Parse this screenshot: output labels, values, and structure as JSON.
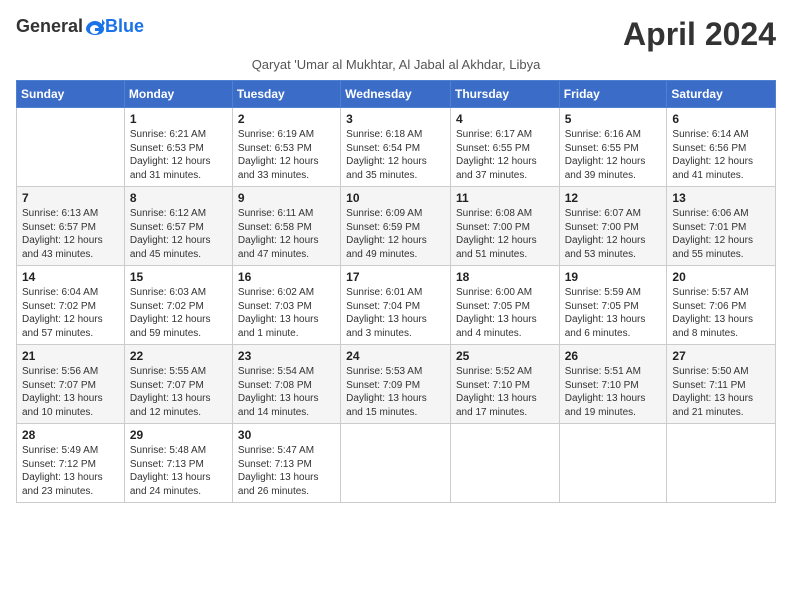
{
  "header": {
    "logo_general": "General",
    "logo_blue": "Blue",
    "month_title": "April 2024",
    "subtitle": "Qaryat 'Umar al Mukhtar, Al Jabal al Akhdar, Libya"
  },
  "columns": [
    "Sunday",
    "Monday",
    "Tuesday",
    "Wednesday",
    "Thursday",
    "Friday",
    "Saturday"
  ],
  "weeks": [
    [
      {
        "day": "",
        "info": ""
      },
      {
        "day": "1",
        "info": "Sunrise: 6:21 AM\nSunset: 6:53 PM\nDaylight: 12 hours\nand 31 minutes."
      },
      {
        "day": "2",
        "info": "Sunrise: 6:19 AM\nSunset: 6:53 PM\nDaylight: 12 hours\nand 33 minutes."
      },
      {
        "day": "3",
        "info": "Sunrise: 6:18 AM\nSunset: 6:54 PM\nDaylight: 12 hours\nand 35 minutes."
      },
      {
        "day": "4",
        "info": "Sunrise: 6:17 AM\nSunset: 6:55 PM\nDaylight: 12 hours\nand 37 minutes."
      },
      {
        "day": "5",
        "info": "Sunrise: 6:16 AM\nSunset: 6:55 PM\nDaylight: 12 hours\nand 39 minutes."
      },
      {
        "day": "6",
        "info": "Sunrise: 6:14 AM\nSunset: 6:56 PM\nDaylight: 12 hours\nand 41 minutes."
      }
    ],
    [
      {
        "day": "7",
        "info": "Sunrise: 6:13 AM\nSunset: 6:57 PM\nDaylight: 12 hours\nand 43 minutes."
      },
      {
        "day": "8",
        "info": "Sunrise: 6:12 AM\nSunset: 6:57 PM\nDaylight: 12 hours\nand 45 minutes."
      },
      {
        "day": "9",
        "info": "Sunrise: 6:11 AM\nSunset: 6:58 PM\nDaylight: 12 hours\nand 47 minutes."
      },
      {
        "day": "10",
        "info": "Sunrise: 6:09 AM\nSunset: 6:59 PM\nDaylight: 12 hours\nand 49 minutes."
      },
      {
        "day": "11",
        "info": "Sunrise: 6:08 AM\nSunset: 7:00 PM\nDaylight: 12 hours\nand 51 minutes."
      },
      {
        "day": "12",
        "info": "Sunrise: 6:07 AM\nSunset: 7:00 PM\nDaylight: 12 hours\nand 53 minutes."
      },
      {
        "day": "13",
        "info": "Sunrise: 6:06 AM\nSunset: 7:01 PM\nDaylight: 12 hours\nand 55 minutes."
      }
    ],
    [
      {
        "day": "14",
        "info": "Sunrise: 6:04 AM\nSunset: 7:02 PM\nDaylight: 12 hours\nand 57 minutes."
      },
      {
        "day": "15",
        "info": "Sunrise: 6:03 AM\nSunset: 7:02 PM\nDaylight: 12 hours\nand 59 minutes."
      },
      {
        "day": "16",
        "info": "Sunrise: 6:02 AM\nSunset: 7:03 PM\nDaylight: 13 hours\nand 1 minute."
      },
      {
        "day": "17",
        "info": "Sunrise: 6:01 AM\nSunset: 7:04 PM\nDaylight: 13 hours\nand 3 minutes."
      },
      {
        "day": "18",
        "info": "Sunrise: 6:00 AM\nSunset: 7:05 PM\nDaylight: 13 hours\nand 4 minutes."
      },
      {
        "day": "19",
        "info": "Sunrise: 5:59 AM\nSunset: 7:05 PM\nDaylight: 13 hours\nand 6 minutes."
      },
      {
        "day": "20",
        "info": "Sunrise: 5:57 AM\nSunset: 7:06 PM\nDaylight: 13 hours\nand 8 minutes."
      }
    ],
    [
      {
        "day": "21",
        "info": "Sunrise: 5:56 AM\nSunset: 7:07 PM\nDaylight: 13 hours\nand 10 minutes."
      },
      {
        "day": "22",
        "info": "Sunrise: 5:55 AM\nSunset: 7:07 PM\nDaylight: 13 hours\nand 12 minutes."
      },
      {
        "day": "23",
        "info": "Sunrise: 5:54 AM\nSunset: 7:08 PM\nDaylight: 13 hours\nand 14 minutes."
      },
      {
        "day": "24",
        "info": "Sunrise: 5:53 AM\nSunset: 7:09 PM\nDaylight: 13 hours\nand 15 minutes."
      },
      {
        "day": "25",
        "info": "Sunrise: 5:52 AM\nSunset: 7:10 PM\nDaylight: 13 hours\nand 17 minutes."
      },
      {
        "day": "26",
        "info": "Sunrise: 5:51 AM\nSunset: 7:10 PM\nDaylight: 13 hours\nand 19 minutes."
      },
      {
        "day": "27",
        "info": "Sunrise: 5:50 AM\nSunset: 7:11 PM\nDaylight: 13 hours\nand 21 minutes."
      }
    ],
    [
      {
        "day": "28",
        "info": "Sunrise: 5:49 AM\nSunset: 7:12 PM\nDaylight: 13 hours\nand 23 minutes."
      },
      {
        "day": "29",
        "info": "Sunrise: 5:48 AM\nSunset: 7:13 PM\nDaylight: 13 hours\nand 24 minutes."
      },
      {
        "day": "30",
        "info": "Sunrise: 5:47 AM\nSunset: 7:13 PM\nDaylight: 13 hours\nand 26 minutes."
      },
      {
        "day": "",
        "info": ""
      },
      {
        "day": "",
        "info": ""
      },
      {
        "day": "",
        "info": ""
      },
      {
        "day": "",
        "info": ""
      }
    ]
  ]
}
